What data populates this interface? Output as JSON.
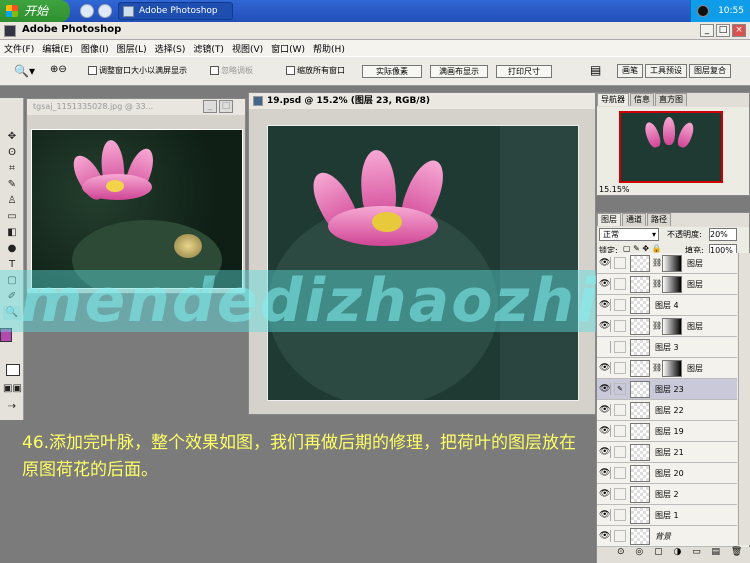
{
  "taskbar": {
    "start": "开始",
    "task": "Adobe Photoshop",
    "clock": "10:55"
  },
  "app": {
    "title": "Adobe Photoshop"
  },
  "menu": [
    "文件(F)",
    "编辑(E)",
    "图像(I)",
    "图层(L)",
    "选择(S)",
    "滤镜(T)",
    "视图(V)",
    "窗口(W)",
    "帮助(H)"
  ],
  "options": {
    "chk1": "调整窗口大小以满屏显示",
    "chk2": "忽略调板",
    "chk3": "缩放所有窗口",
    "btn1": "实际像素",
    "btn2": "满画布显示",
    "btn3": "打印尺寸",
    "tab1": "画笔",
    "tab2": "工具预设",
    "tab3": "图层复合"
  },
  "doc1": {
    "title": "tgsaj_1151335028.jpg @ 33..."
  },
  "doc2": {
    "title": "19.psd @ 15.2% (图层 23, RGB/8)"
  },
  "watermark": "mendedizhaozhi",
  "caption": "46.添加完叶脉，整个效果如图，我们再做后期的修理，把荷叶的图层放在原图荷花的后面。",
  "navigator": {
    "tabs": [
      "导航器",
      "信息",
      "直方图"
    ],
    "zoom": "15.15%"
  },
  "layers": {
    "tabs": [
      "图层",
      "通道",
      "路径"
    ],
    "blend": "正常",
    "opacity_label": "不透明度:",
    "opacity": "20%",
    "lock_label": "锁定:",
    "fill_label": "填充:",
    "fill": "100%",
    "rows": [
      {
        "name": "图层",
        "mask": true,
        "vis": true
      },
      {
        "name": "图层",
        "mask": true,
        "vis": true
      },
      {
        "name": "图层 4",
        "mask": false,
        "vis": true
      },
      {
        "name": "图层",
        "mask": true,
        "vis": true
      },
      {
        "name": "图层 3",
        "mask": false,
        "vis": false
      },
      {
        "name": "图层",
        "mask": true,
        "vis": true
      },
      {
        "name": "图层 23",
        "mask": false,
        "vis": true,
        "sel": true
      },
      {
        "name": "图层 22",
        "mask": false,
        "vis": true
      },
      {
        "name": "图层 19",
        "mask": false,
        "vis": true
      },
      {
        "name": "图层 21",
        "mask": false,
        "vis": true
      },
      {
        "name": "图层 20",
        "mask": false,
        "vis": true
      },
      {
        "name": "图层 2",
        "mask": false,
        "vis": true
      },
      {
        "name": "图层 1",
        "mask": false,
        "vis": true
      },
      {
        "name": "背景",
        "mask": false,
        "vis": true
      }
    ],
    "footer": "⊙ ◎ ▢ ◑ ▭ ▤ 🗑"
  }
}
